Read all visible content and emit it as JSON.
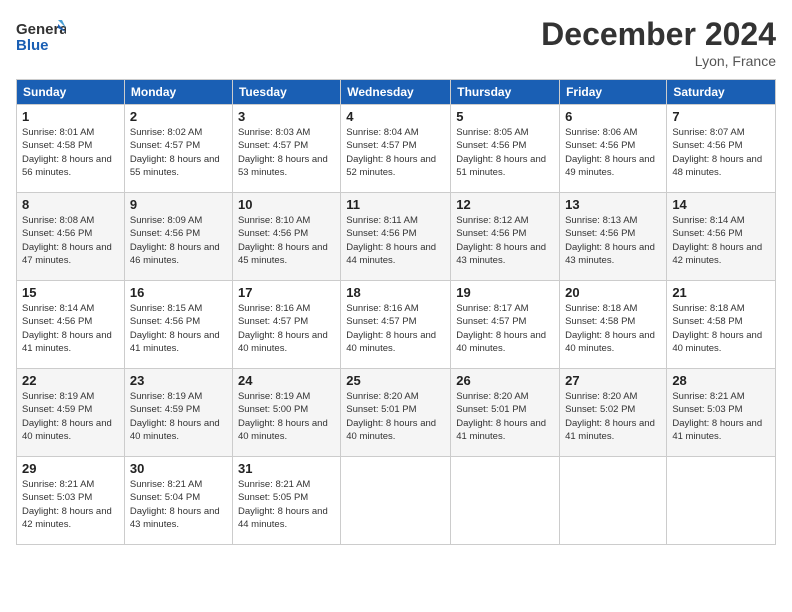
{
  "logo": {
    "line1": "General",
    "line2": "Blue"
  },
  "title": "December 2024",
  "location": "Lyon, France",
  "weekdays": [
    "Sunday",
    "Monday",
    "Tuesday",
    "Wednesday",
    "Thursday",
    "Friday",
    "Saturday"
  ],
  "weeks": [
    [
      {
        "day": "1",
        "sunrise": "8:01 AM",
        "sunset": "4:58 PM",
        "daylight": "8 hours and 56 minutes."
      },
      {
        "day": "2",
        "sunrise": "8:02 AM",
        "sunset": "4:57 PM",
        "daylight": "8 hours and 55 minutes."
      },
      {
        "day": "3",
        "sunrise": "8:03 AM",
        "sunset": "4:57 PM",
        "daylight": "8 hours and 53 minutes."
      },
      {
        "day": "4",
        "sunrise": "8:04 AM",
        "sunset": "4:57 PM",
        "daylight": "8 hours and 52 minutes."
      },
      {
        "day": "5",
        "sunrise": "8:05 AM",
        "sunset": "4:56 PM",
        "daylight": "8 hours and 51 minutes."
      },
      {
        "day": "6",
        "sunrise": "8:06 AM",
        "sunset": "4:56 PM",
        "daylight": "8 hours and 49 minutes."
      },
      {
        "day": "7",
        "sunrise": "8:07 AM",
        "sunset": "4:56 PM",
        "daylight": "8 hours and 48 minutes."
      }
    ],
    [
      {
        "day": "8",
        "sunrise": "8:08 AM",
        "sunset": "4:56 PM",
        "daylight": "8 hours and 47 minutes."
      },
      {
        "day": "9",
        "sunrise": "8:09 AM",
        "sunset": "4:56 PM",
        "daylight": "8 hours and 46 minutes."
      },
      {
        "day": "10",
        "sunrise": "8:10 AM",
        "sunset": "4:56 PM",
        "daylight": "8 hours and 45 minutes."
      },
      {
        "day": "11",
        "sunrise": "8:11 AM",
        "sunset": "4:56 PM",
        "daylight": "8 hours and 44 minutes."
      },
      {
        "day": "12",
        "sunrise": "8:12 AM",
        "sunset": "4:56 PM",
        "daylight": "8 hours and 43 minutes."
      },
      {
        "day": "13",
        "sunrise": "8:13 AM",
        "sunset": "4:56 PM",
        "daylight": "8 hours and 43 minutes."
      },
      {
        "day": "14",
        "sunrise": "8:14 AM",
        "sunset": "4:56 PM",
        "daylight": "8 hours and 42 minutes."
      }
    ],
    [
      {
        "day": "15",
        "sunrise": "8:14 AM",
        "sunset": "4:56 PM",
        "daylight": "8 hours and 41 minutes."
      },
      {
        "day": "16",
        "sunrise": "8:15 AM",
        "sunset": "4:56 PM",
        "daylight": "8 hours and 41 minutes."
      },
      {
        "day": "17",
        "sunrise": "8:16 AM",
        "sunset": "4:57 PM",
        "daylight": "8 hours and 40 minutes."
      },
      {
        "day": "18",
        "sunrise": "8:16 AM",
        "sunset": "4:57 PM",
        "daylight": "8 hours and 40 minutes."
      },
      {
        "day": "19",
        "sunrise": "8:17 AM",
        "sunset": "4:57 PM",
        "daylight": "8 hours and 40 minutes."
      },
      {
        "day": "20",
        "sunrise": "8:18 AM",
        "sunset": "4:58 PM",
        "daylight": "8 hours and 40 minutes."
      },
      {
        "day": "21",
        "sunrise": "8:18 AM",
        "sunset": "4:58 PM",
        "daylight": "8 hours and 40 minutes."
      }
    ],
    [
      {
        "day": "22",
        "sunrise": "8:19 AM",
        "sunset": "4:59 PM",
        "daylight": "8 hours and 40 minutes."
      },
      {
        "day": "23",
        "sunrise": "8:19 AM",
        "sunset": "4:59 PM",
        "daylight": "8 hours and 40 minutes."
      },
      {
        "day": "24",
        "sunrise": "8:19 AM",
        "sunset": "5:00 PM",
        "daylight": "8 hours and 40 minutes."
      },
      {
        "day": "25",
        "sunrise": "8:20 AM",
        "sunset": "5:01 PM",
        "daylight": "8 hours and 40 minutes."
      },
      {
        "day": "26",
        "sunrise": "8:20 AM",
        "sunset": "5:01 PM",
        "daylight": "8 hours and 41 minutes."
      },
      {
        "day": "27",
        "sunrise": "8:20 AM",
        "sunset": "5:02 PM",
        "daylight": "8 hours and 41 minutes."
      },
      {
        "day": "28",
        "sunrise": "8:21 AM",
        "sunset": "5:03 PM",
        "daylight": "8 hours and 41 minutes."
      }
    ],
    [
      {
        "day": "29",
        "sunrise": "8:21 AM",
        "sunset": "5:03 PM",
        "daylight": "8 hours and 42 minutes."
      },
      {
        "day": "30",
        "sunrise": "8:21 AM",
        "sunset": "5:04 PM",
        "daylight": "8 hours and 43 minutes."
      },
      {
        "day": "31",
        "sunrise": "8:21 AM",
        "sunset": "5:05 PM",
        "daylight": "8 hours and 44 minutes."
      },
      null,
      null,
      null,
      null
    ]
  ]
}
